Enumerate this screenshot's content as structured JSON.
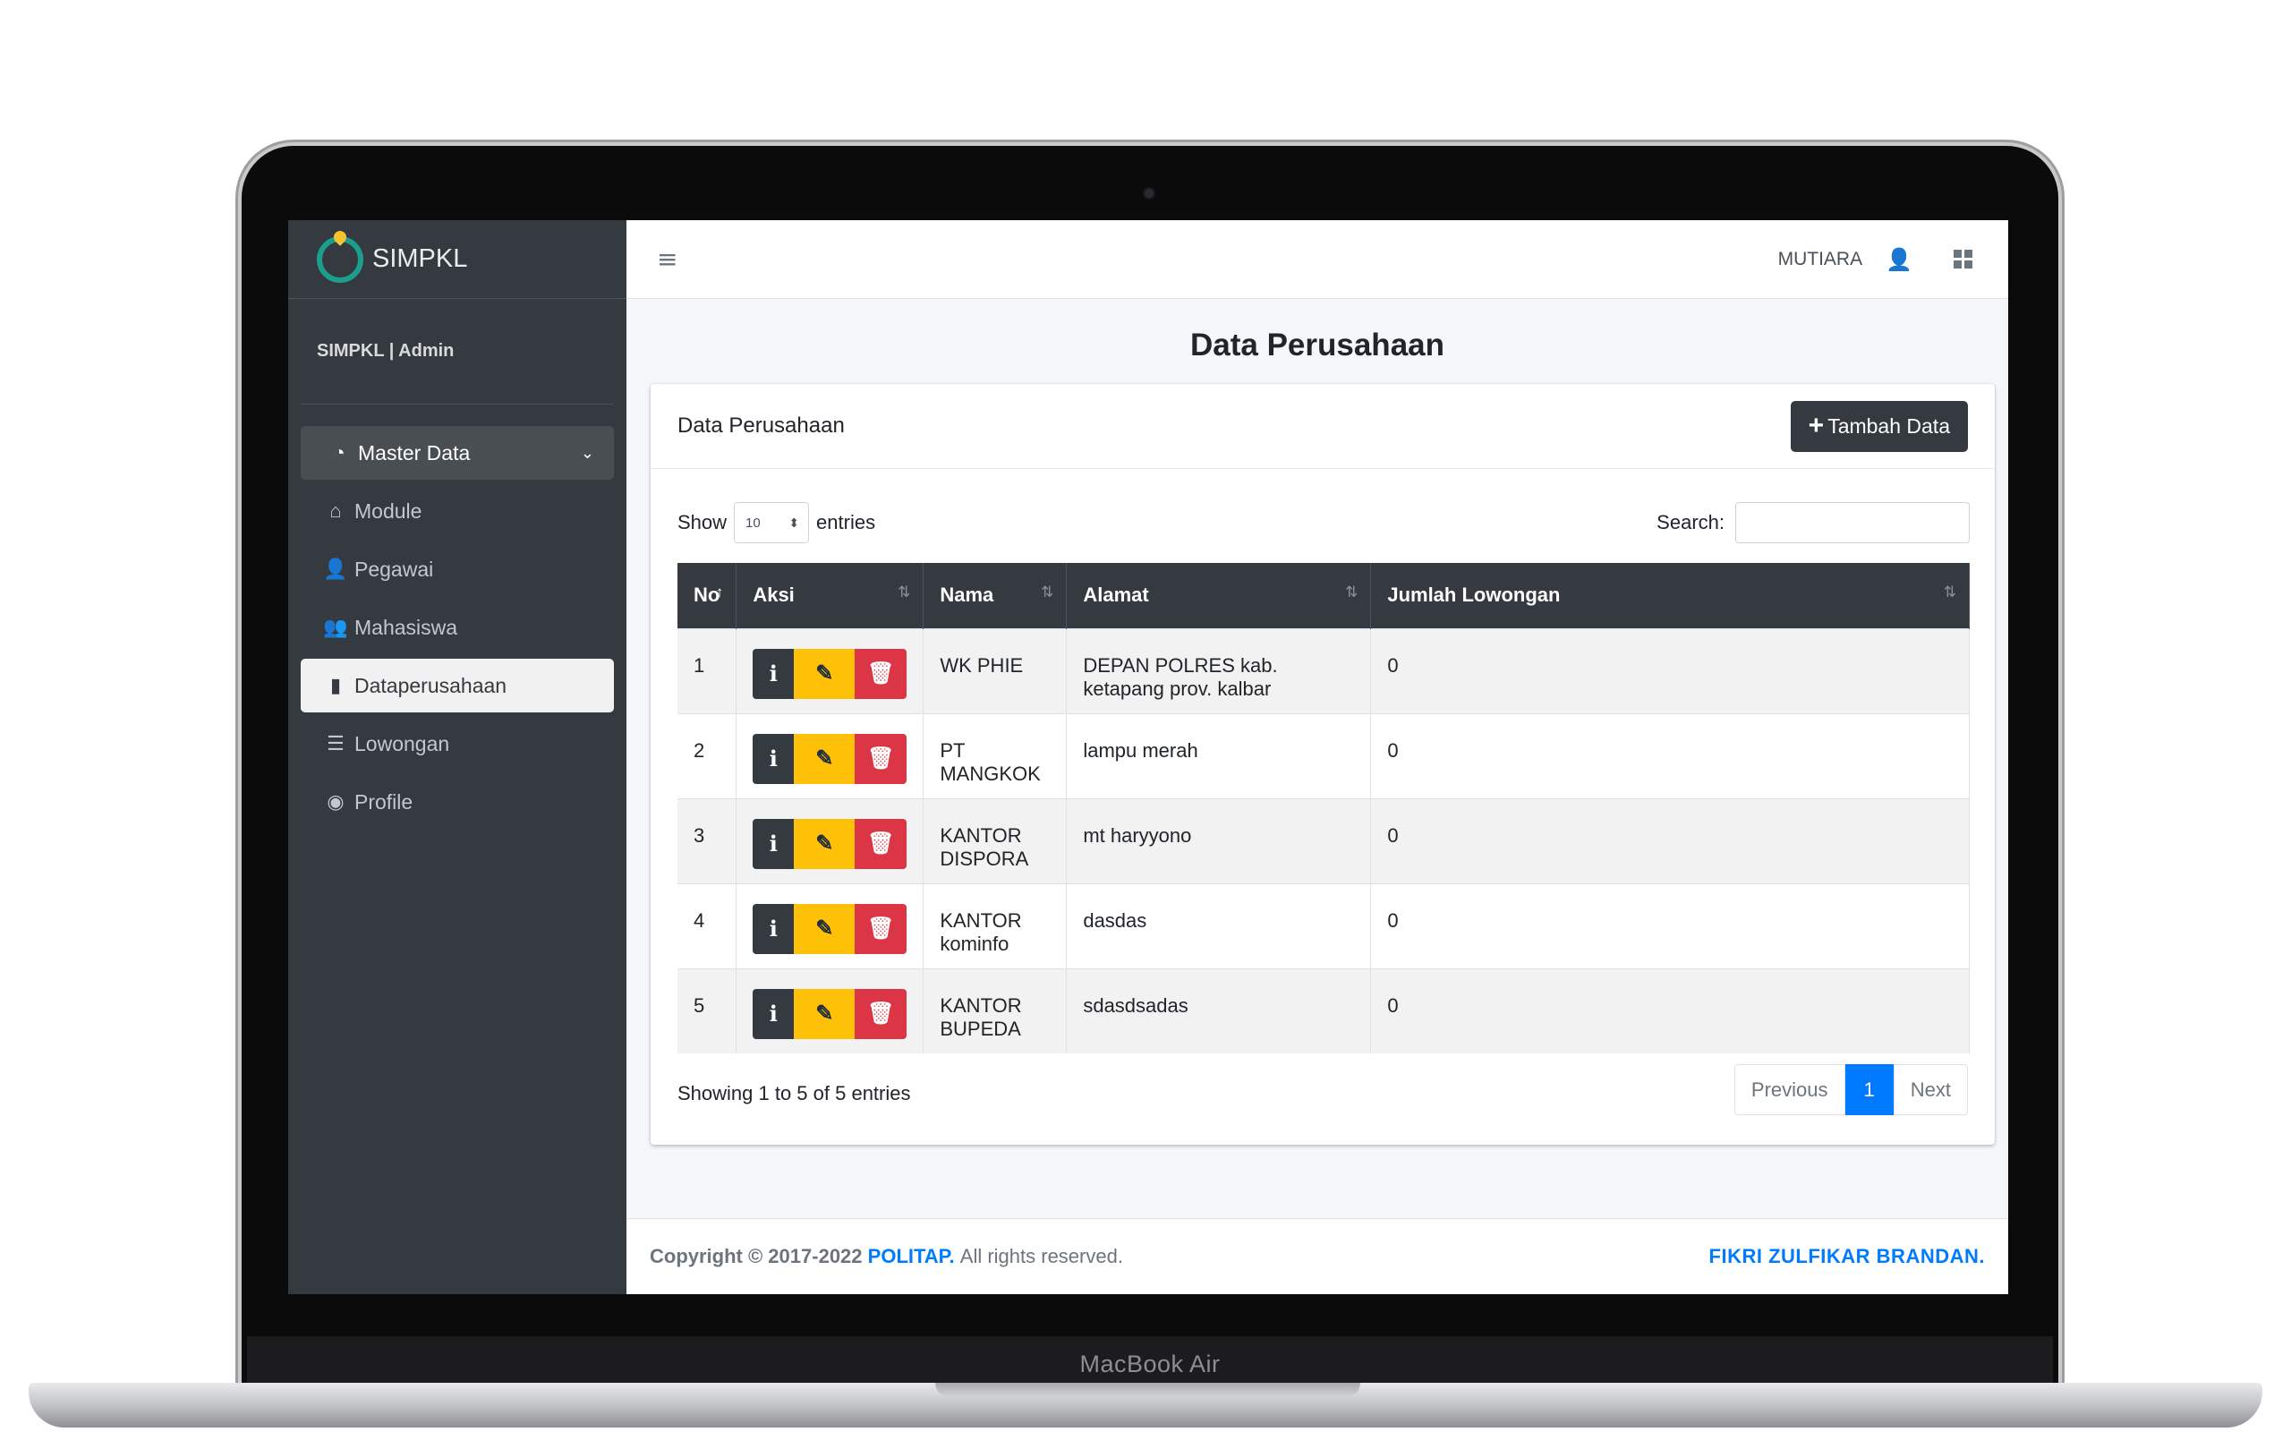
{
  "device": {
    "label": "MacBook Air"
  },
  "brand": {
    "name": "SIMPKL"
  },
  "user_panel": {
    "name": "SIMPKL | Admin"
  },
  "sidebar": {
    "items": [
      {
        "label": "Master Data",
        "icon": "tachometer-icon",
        "state": "expanded"
      },
      {
        "label": "Module",
        "icon": "home-icon"
      },
      {
        "label": "Pegawai",
        "icon": "user-icon"
      },
      {
        "label": "Mahasiswa",
        "icon": "users-icon"
      },
      {
        "label": "Dataperusahaan",
        "icon": "building-icon",
        "state": "active"
      },
      {
        "label": "Lowongan",
        "icon": "list-icon"
      },
      {
        "label": "Profile",
        "icon": "user-circle-icon"
      }
    ]
  },
  "topbar": {
    "user": "MUTIARA",
    "icons": [
      "hamburger-icon",
      "user-icon",
      "grid-icon"
    ]
  },
  "page": {
    "title": "Data Perusahaan"
  },
  "card": {
    "title": "Data Perusahaan",
    "add_button": "Tambah Data"
  },
  "controls": {
    "show_label": "Show",
    "entries_label": "entries",
    "page_length": "10",
    "search_label": "Search:",
    "search_value": ""
  },
  "table": {
    "headers": [
      "No",
      "Aksi",
      "Nama",
      "Alamat",
      "Jumlah Lowongan"
    ],
    "rows": [
      {
        "no": "1",
        "nama": "WK PHIE",
        "alamat": "DEPAN POLRES kab. ketapang prov. kalbar",
        "jumlah": "0"
      },
      {
        "no": "2",
        "nama": "PT MANGKOK",
        "alamat": "lampu merah",
        "jumlah": "0"
      },
      {
        "no": "3",
        "nama": "KANTOR DISPORA",
        "alamat": "mt haryyono",
        "jumlah": "0"
      },
      {
        "no": "4",
        "nama": "KANTOR kominfo",
        "alamat": "dasdas",
        "jumlah": "0"
      },
      {
        "no": "5",
        "nama": "KANTOR BUPEDA",
        "alamat": "sdasdsadas",
        "jumlah": "0"
      }
    ]
  },
  "table_info": "Showing 1 to 5 of 5 entries",
  "pagination": {
    "previous": "Previous",
    "current": "1",
    "next": "Next"
  },
  "footer": {
    "copyright": "Copyright © 2017-2022",
    "org": "POLITAP.",
    "rights": "All rights reserved.",
    "author": "FIKRI ZULFIKAR BRANDAN."
  },
  "colors": {
    "sidebar": "#343a40",
    "primary": "#007bff",
    "warning": "#ffc107",
    "danger": "#dc3545"
  }
}
